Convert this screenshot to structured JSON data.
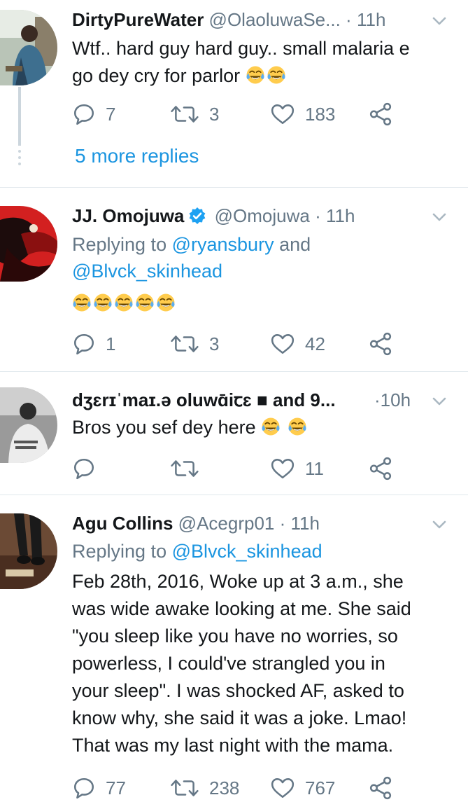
{
  "tweets": [
    {
      "name": "DirtyPureWater",
      "handle": "@OlaoluwaSe...",
      "time": "11h",
      "text": "Wtf.. hard guy hard guy.. small malaria e go dey cry for parlor",
      "text_line1": "Wtf.. hard guy hard guy.. small malaria e",
      "text_line2": "go dey cry for parlor",
      "emoji_count": 2,
      "replies": "7",
      "retweets": "3",
      "likes": "183",
      "more_replies": "5 more replies"
    },
    {
      "name": "JJ. Omojuwa",
      "verified": true,
      "handle": "@Omojuwa",
      "time": "11h",
      "replying_prefix": "Replying to",
      "replying_to_1": "@ryansbury",
      "replying_joiner": "and",
      "replying_to_2": "@Blvck_skinhead",
      "emoji_count": 5,
      "replies": "1",
      "retweets": "3",
      "likes": "42"
    },
    {
      "name": "dʒɛrɪˈmaɪ.ə oluwɑ̄iꞇɛ ■ and 9...",
      "time": "10h",
      "text": "Bros you sef dey here",
      "emoji_count": 2,
      "replies": "",
      "retweets": "",
      "likes": "11"
    },
    {
      "name": "Agu Collins",
      "handle": "@Acegrp01",
      "time": "11h",
      "replying_prefix": "Replying to",
      "replying_to_1": "@Blvck_skinhead",
      "lines": [
        "Feb 28th, 2016, Woke up at 3 a.m., she",
        "was wide awake looking at me. She said",
        "\"you sleep like you have no worries, so",
        "powerless, I could've strangled you in",
        "your sleep\". I was shocked AF, asked to",
        "know why, she said it was a joke. Lmao!",
        "That was my last night with the mama."
      ],
      "replies": "77",
      "retweets": "238",
      "likes": "767"
    }
  ],
  "colors": {
    "text": "#14171a",
    "muted": "#657786",
    "link": "#1b95e0",
    "divider": "#e1e8ed",
    "thread_line": "#ccd6dd",
    "verified": "#1da1f2"
  },
  "icons": [
    "reply-icon",
    "retweet-icon",
    "like-icon",
    "share-icon",
    "chevron-down-icon",
    "verified-badge-icon",
    "tears-of-joy-emoji"
  ]
}
